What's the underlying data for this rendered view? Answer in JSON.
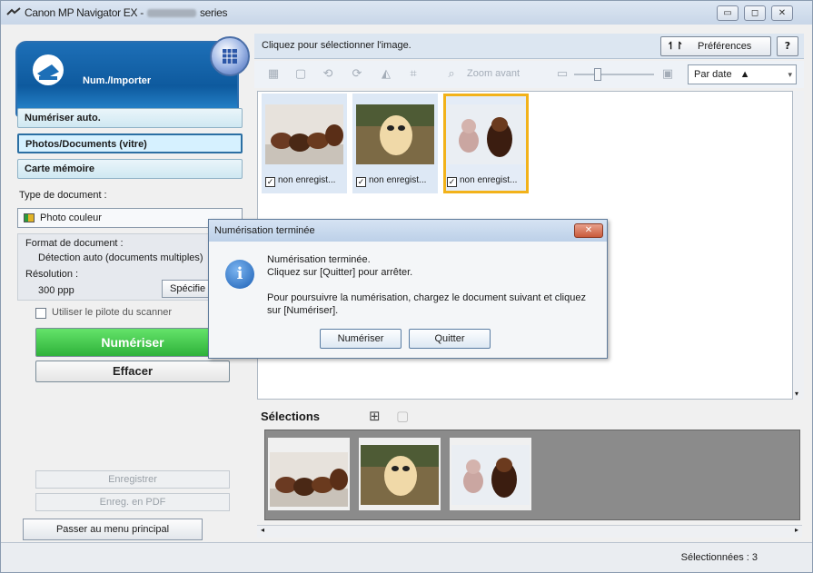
{
  "window": {
    "title": "Canon MP Navigator EX - ",
    "title_suffix": "series"
  },
  "sidebar": {
    "banner_label": "Num./Importer",
    "nav": [
      {
        "label": "Numériser auto."
      },
      {
        "label": "Photos/Documents (vitre)"
      },
      {
        "label": "Carte mémoire"
      }
    ],
    "doc_type_label": "Type de document :",
    "doc_type_value": "Photo couleur",
    "format_label": "Format de document :",
    "format_value": "Détection auto (documents multiples)",
    "resolution_label": "Résolution :",
    "resolution_value": "300 ppp",
    "specify_label": "Spécifie",
    "driver_checkbox": "Utiliser le pilote du scanner",
    "scan_button": "Numériser",
    "clear_button": "Effacer",
    "save_button": "Enregistrer",
    "save_pdf_button": "Enreg. en PDF",
    "main_menu_button": "Passer au menu principal"
  },
  "main": {
    "header_text": "Cliquez pour sélectionner l'image.",
    "preferences_label": "Préférences",
    "help_label": "?",
    "zoom_label": "Zoom avant",
    "sort_label": "Par date",
    "thumbnails": [
      {
        "caption": "non enregist...",
        "checked": true,
        "selected": false
      },
      {
        "caption": "non enregist...",
        "checked": true,
        "selected": false
      },
      {
        "caption": "non enregist...",
        "checked": true,
        "selected": true
      }
    ],
    "selections_label": "Sélections"
  },
  "status": {
    "selected": "Sélectionnées : 3"
  },
  "dialog": {
    "title": "Numérisation terminée",
    "line1": "Numérisation terminée.",
    "line2": "Cliquez sur [Quitter] pour arrêter.",
    "line3": "Pour poursuivre la numérisation, chargez le document suivant et cliquez",
    "line4": "sur [Numériser].",
    "scan_button": "Numériser",
    "quit_button": "Quitter"
  }
}
